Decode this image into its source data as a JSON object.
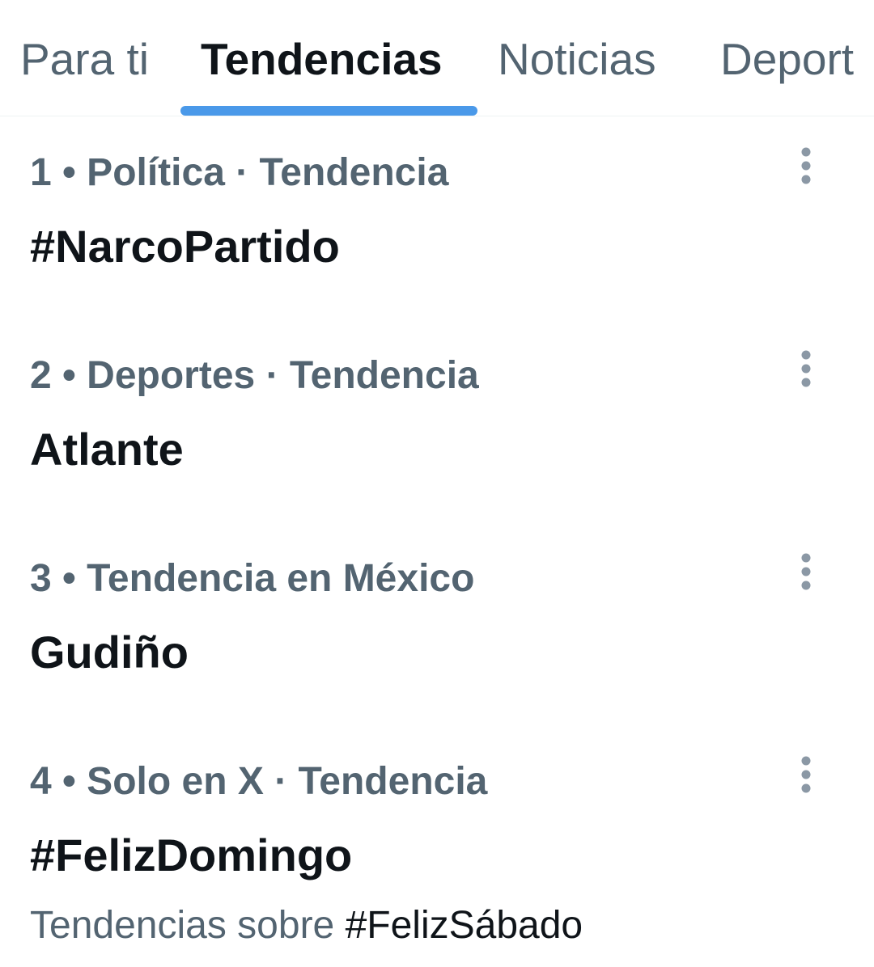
{
  "tabs": [
    {
      "label": "Para ti",
      "active": false
    },
    {
      "label": "Tendencias",
      "active": true
    },
    {
      "label": "Noticias",
      "active": false
    },
    {
      "label": "Deport",
      "active": false
    }
  ],
  "trends": [
    {
      "meta": "1 • Política · Tendencia",
      "title": "#NarcoPartido"
    },
    {
      "meta": "2 • Deportes · Tendencia",
      "title": "Atlante"
    },
    {
      "meta": "3 • Tendencia en México",
      "title": "Gudiño"
    },
    {
      "meta": "4 • Solo en X · Tendencia",
      "title": "#FelizDomingo",
      "related_prefix": "Tendencias sobre",
      "related_tag": "#FelizSábado"
    }
  ],
  "icons": {
    "more": "more-vertical-icon"
  },
  "colors": {
    "primary_text": "#0f1419",
    "secondary_text": "#536471",
    "accent": "#4a99e9",
    "divider": "#eff3f4"
  }
}
